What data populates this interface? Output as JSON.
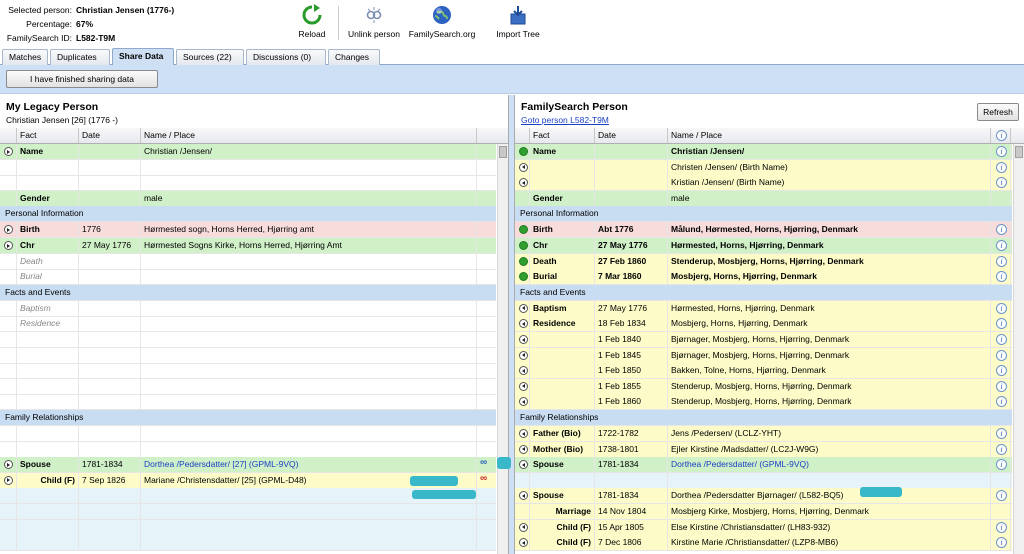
{
  "header": {
    "selected_label": "Selected person:",
    "selected_value": "Christian Jensen (1776-)",
    "percentage_label": "Percentage:",
    "percentage_value": "67%",
    "fsid_label": "FamilySearch ID:",
    "fsid_value": "L582-T9M"
  },
  "toolbar": {
    "reload": "Reload",
    "unlink": "Unlink person",
    "familysearch": "FamilySearch.org",
    "import": "Import Tree"
  },
  "tabs": [
    "Matches",
    "Duplicates",
    "Share Data",
    "Sources (22)",
    "Discussions (0)",
    "Changes"
  ],
  "active_tab": "Share Data",
  "finish_button": "I have finished sharing data",
  "left": {
    "title": "My Legacy Person",
    "subtitle": "Christian Jensen [26] (1776 -)",
    "columns": [
      "Fact",
      "Date",
      "Name / Place"
    ],
    "rows": [
      {
        "type": "data",
        "color": "green",
        "arrow": "r",
        "fact": "Name",
        "date": "",
        "place": "Christian /Jensen/",
        "bold": true
      },
      {
        "type": "data",
        "color": "",
        "arrow": "",
        "fact": "",
        "date": "",
        "place": ""
      },
      {
        "type": "data",
        "color": "",
        "arrow": "",
        "fact": "",
        "date": "",
        "place": ""
      },
      {
        "type": "data",
        "color": "green",
        "arrow": "",
        "fact": "Gender",
        "date": "",
        "place": "male",
        "bold": true
      },
      {
        "type": "section",
        "label": "Personal Information"
      },
      {
        "type": "data",
        "color": "pink",
        "arrow": "r",
        "fact": "Birth",
        "date": "1776",
        "place": "Hørmested sogn, Horns Herred, Hjørring amt",
        "bold": true
      },
      {
        "type": "data",
        "color": "green",
        "arrow": "r",
        "fact": "Chr",
        "date": "27 May 1776",
        "place": "Hørmested Sogns Kirke, Horns Herred, Hjørring Amt",
        "bold": true
      },
      {
        "type": "data",
        "color": "",
        "arrow": "",
        "fact": "Death",
        "date": "",
        "place": "",
        "italic": true
      },
      {
        "type": "data",
        "color": "",
        "arrow": "",
        "fact": "Burial",
        "date": "",
        "place": "",
        "italic": true
      },
      {
        "type": "section",
        "label": "Facts and Events"
      },
      {
        "type": "data",
        "color": "",
        "arrow": "",
        "fact": "Baptism",
        "date": "",
        "place": "",
        "italic": true
      },
      {
        "type": "data",
        "color": "",
        "arrow": "",
        "fact": "Residence",
        "date": "",
        "place": "",
        "italic": true
      },
      {
        "type": "data",
        "color": "",
        "arrow": "",
        "fact": "",
        "date": "",
        "place": ""
      },
      {
        "type": "data",
        "color": "",
        "arrow": "",
        "fact": "",
        "date": "",
        "place": ""
      },
      {
        "type": "data",
        "color": "",
        "arrow": "",
        "fact": "",
        "date": "",
        "place": ""
      },
      {
        "type": "data",
        "color": "",
        "arrow": "",
        "fact": "",
        "date": "",
        "place": ""
      },
      {
        "type": "data",
        "color": "",
        "arrow": "",
        "fact": "",
        "date": "",
        "place": ""
      },
      {
        "type": "section",
        "label": "Family Relationships"
      },
      {
        "type": "data",
        "color": "",
        "arrow": "",
        "fact": "",
        "date": "",
        "place": ""
      },
      {
        "type": "data",
        "color": "",
        "arrow": "",
        "fact": "",
        "date": "",
        "place": ""
      },
      {
        "type": "data",
        "color": "green",
        "arrow": "r",
        "fact": "Spouse",
        "date": "1781-1834",
        "place": "Dorthea /Pedersdatter/ [27] (GPML-9VQ)",
        "bold": true,
        "link": true,
        "chain": true
      },
      {
        "type": "data",
        "color": "yellow",
        "arrow": "r",
        "fact": "Child (F)",
        "date": "7 Sep 1826",
        "place": "Mariane /Christensdatter/ [25] (GPML-D48)",
        "bold": true,
        "indent": true,
        "chain": true
      },
      {
        "type": "data",
        "color": "blue",
        "arrow": "",
        "fact": "",
        "date": "",
        "place": ""
      },
      {
        "type": "data",
        "color": "blue",
        "arrow": "",
        "fact": "",
        "date": "",
        "place": ""
      },
      {
        "type": "data",
        "color": "blue",
        "arrow": "",
        "fact": "",
        "date": "",
        "place": ""
      },
      {
        "type": "data",
        "color": "blue",
        "arrow": "",
        "fact": "",
        "date": "",
        "place": ""
      }
    ]
  },
  "right": {
    "title": "FamilySearch Person",
    "link": "Goto person L582-T9M",
    "refresh": "Refresh",
    "columns": [
      "Fact",
      "Date",
      "Name / Place"
    ],
    "rows": [
      {
        "type": "data",
        "color": "green",
        "arrow": "g",
        "fact": "Name",
        "date": "",
        "place": "Christian /Jensen/",
        "bold": true,
        "placebold": true,
        "info": true
      },
      {
        "type": "data",
        "color": "yellow",
        "arrow": "l",
        "fact": "",
        "date": "",
        "place": "Christen /Jensen/ (Birth Name)",
        "info": true
      },
      {
        "type": "data",
        "color": "yellow",
        "arrow": "l",
        "fact": "",
        "date": "",
        "place": "Kristian /Jensen/ (Birth Name)",
        "info": true
      },
      {
        "type": "data",
        "color": "green",
        "arrow": "",
        "fact": "Gender",
        "date": "",
        "place": "male",
        "bold": true
      },
      {
        "type": "section",
        "label": "Personal Information"
      },
      {
        "type": "data",
        "color": "pink",
        "arrow": "g",
        "fact": "Birth",
        "date": "Abt 1776",
        "place": "Målund, Hørmested, Horns, Hjørring, Denmark",
        "bold": true,
        "placebold": true,
        "datebold": true,
        "info": true
      },
      {
        "type": "data",
        "color": "green",
        "arrow": "g",
        "fact": "Chr",
        "date": "27 May 1776",
        "place": "Hørmested, Horns, Hjørring, Denmark",
        "bold": true,
        "placebold": true,
        "datebold": true,
        "info": true
      },
      {
        "type": "data",
        "color": "yellow",
        "arrow": "g",
        "fact": "Death",
        "date": "27 Feb 1860",
        "place": "Stenderup, Mosbjerg, Horns, Hjørring, Denmark",
        "bold": true,
        "placebold": true,
        "datebold": true,
        "info": true
      },
      {
        "type": "data",
        "color": "yellow",
        "arrow": "g",
        "fact": "Burial",
        "date": "7 Mar 1860",
        "place": "Mosbjerg, Horns, Hjørring, Denmark",
        "bold": true,
        "placebold": true,
        "datebold": true,
        "info": true
      },
      {
        "type": "section",
        "label": "Facts and Events"
      },
      {
        "type": "data",
        "color": "yellow",
        "arrow": "l",
        "fact": "Baptism",
        "date": "27 May 1776",
        "place": "Hørmested, Horns, Hjørring, Denmark",
        "bold": true,
        "info": true
      },
      {
        "type": "data",
        "color": "yellow",
        "arrow": "l",
        "fact": "Residence",
        "date": "18 Feb 1834",
        "place": "Mosbjerg, Horns, Hjørring, Denmark",
        "bold": true,
        "info": true
      },
      {
        "type": "data",
        "color": "yellow",
        "arrow": "l",
        "fact": "",
        "date": "1 Feb 1840",
        "place": "Bjørnager, Mosbjerg, Horns, Hjørring, Denmark",
        "info": true
      },
      {
        "type": "data",
        "color": "yellow",
        "arrow": "l",
        "fact": "",
        "date": "1 Feb 1845",
        "place": "Bjørnager, Mosbjerg, Horns, Hjørring, Denmark",
        "info": true
      },
      {
        "type": "data",
        "color": "yellow",
        "arrow": "l",
        "fact": "",
        "date": "1 Feb 1850",
        "place": "Bakken, Tolne, Horns, Hjørring, Denmark",
        "info": true
      },
      {
        "type": "data",
        "color": "yellow",
        "arrow": "l",
        "fact": "",
        "date": "1 Feb 1855",
        "place": "Stenderup, Mosbjerg, Horns, Hjørring, Denmark",
        "info": true
      },
      {
        "type": "data",
        "color": "yellow",
        "arrow": "l",
        "fact": "",
        "date": "1 Feb 1860",
        "place": "Stenderup, Mosbjerg, Horns, Hjørring, Denmark",
        "info": true
      },
      {
        "type": "section",
        "label": "Family Relationships"
      },
      {
        "type": "data",
        "color": "yellow",
        "arrow": "l",
        "fact": "Father (Bio)",
        "date": "1722-1782",
        "place": "Jens /Pedersen/ (LCLZ-YHT)",
        "bold": true,
        "info": true
      },
      {
        "type": "data",
        "color": "yellow",
        "arrow": "l",
        "fact": "Mother (Bio)",
        "date": "1738-1801",
        "place": "Ejler Kirstine /Madsdatter/ (LC2J-W9G)",
        "bold": true,
        "info": true
      },
      {
        "type": "data",
        "color": "green",
        "arrow": "l",
        "fact": "Spouse",
        "date": "1781-1834",
        "place": "Dorthea /Pedersdatter/ (GPML-9VQ)",
        "bold": true,
        "link": true,
        "info": true
      },
      {
        "type": "data",
        "color": "blue",
        "arrow": "",
        "fact": "",
        "date": "",
        "place": ""
      },
      {
        "type": "data",
        "color": "yellow",
        "arrow": "l",
        "fact": "Spouse",
        "date": "1781-1834",
        "place": "Dorthea /Pedersdatter Bjørnager/ (L582-BQ5)",
        "bold": true,
        "info": true
      },
      {
        "type": "data",
        "color": "yellow",
        "arrow": "",
        "fact": "Marriage",
        "date": "14 Nov 1804",
        "place": "Mosbjerg Kirke, Mosbjerg, Horns, Hjørring, Denmark",
        "bold": true,
        "indent": true
      },
      {
        "type": "data",
        "color": "yellow",
        "arrow": "l",
        "fact": "Child (F)",
        "date": "15 Apr 1805",
        "place": "Else Kirstine /Christiansdatter/ (LH83-932)",
        "bold": true,
        "indent": true,
        "info": true
      },
      {
        "type": "data",
        "color": "yellow",
        "arrow": "l",
        "fact": "Child (F)",
        "date": "7 Dec 1806",
        "place": "Kirstine Marie /Christiansdatter/ (LZP8-MB6)",
        "bold": true,
        "indent": true,
        "info": true
      }
    ]
  }
}
